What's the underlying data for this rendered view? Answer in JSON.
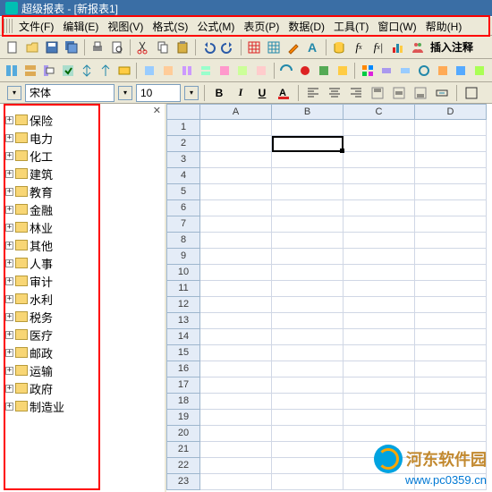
{
  "title": "超级报表 - [新报表1]",
  "menu": [
    "文件(F)",
    "编辑(E)",
    "视图(V)",
    "格式(S)",
    "公式(M)",
    "表页(P)",
    "数据(D)",
    "工具(T)",
    "窗口(W)",
    "帮助(H)"
  ],
  "tree": [
    "保险",
    "电力",
    "化工",
    "建筑",
    "教育",
    "金融",
    "林业",
    "其他",
    "人事",
    "审计",
    "水利",
    "税务",
    "医疗",
    "邮政",
    "运输",
    "政府",
    "制造业"
  ],
  "font": {
    "name": "宋体",
    "size": "10"
  },
  "cols": [
    "A",
    "B",
    "C",
    "D"
  ],
  "rows": 23,
  "selected": {
    "row": 2,
    "col": "B"
  },
  "insert_comment": "插入注释",
  "fmt": {
    "bold": "B",
    "italic": "I",
    "underline": "U"
  },
  "watermark": {
    "name": "河东软件园",
    "url": "www.pc0359.cn"
  }
}
